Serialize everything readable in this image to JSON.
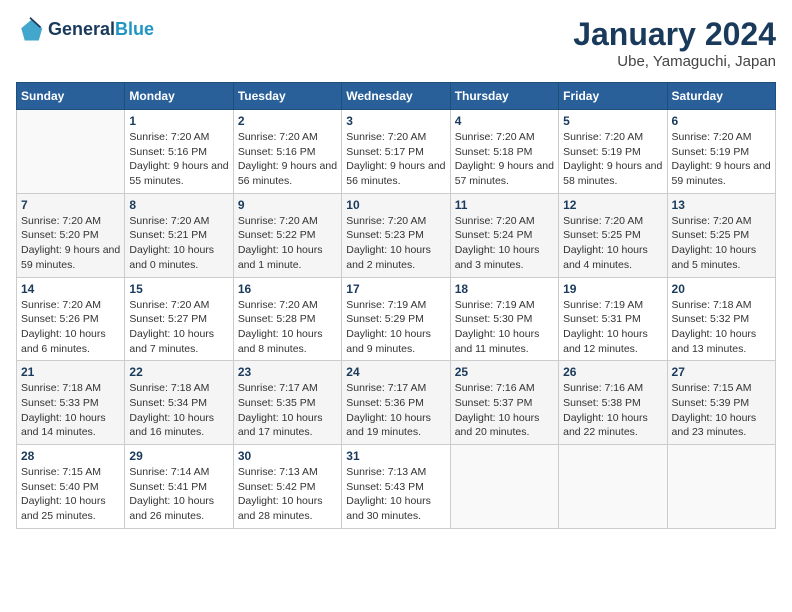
{
  "header": {
    "logo_line1": "General",
    "logo_line2": "Blue",
    "title": "January 2024",
    "subtitle": "Ube, Yamaguchi, Japan"
  },
  "days_of_week": [
    "Sunday",
    "Monday",
    "Tuesday",
    "Wednesday",
    "Thursday",
    "Friday",
    "Saturday"
  ],
  "weeks": [
    [
      {
        "day": "",
        "sunrise": "",
        "sunset": "",
        "daylight": ""
      },
      {
        "day": "1",
        "sunrise": "Sunrise: 7:20 AM",
        "sunset": "Sunset: 5:16 PM",
        "daylight": "Daylight: 9 hours and 55 minutes."
      },
      {
        "day": "2",
        "sunrise": "Sunrise: 7:20 AM",
        "sunset": "Sunset: 5:16 PM",
        "daylight": "Daylight: 9 hours and 56 minutes."
      },
      {
        "day": "3",
        "sunrise": "Sunrise: 7:20 AM",
        "sunset": "Sunset: 5:17 PM",
        "daylight": "Daylight: 9 hours and 56 minutes."
      },
      {
        "day": "4",
        "sunrise": "Sunrise: 7:20 AM",
        "sunset": "Sunset: 5:18 PM",
        "daylight": "Daylight: 9 hours and 57 minutes."
      },
      {
        "day": "5",
        "sunrise": "Sunrise: 7:20 AM",
        "sunset": "Sunset: 5:19 PM",
        "daylight": "Daylight: 9 hours and 58 minutes."
      },
      {
        "day": "6",
        "sunrise": "Sunrise: 7:20 AM",
        "sunset": "Sunset: 5:19 PM",
        "daylight": "Daylight: 9 hours and 59 minutes."
      }
    ],
    [
      {
        "day": "7",
        "sunrise": "Sunrise: 7:20 AM",
        "sunset": "Sunset: 5:20 PM",
        "daylight": "Daylight: 9 hours and 59 minutes."
      },
      {
        "day": "8",
        "sunrise": "Sunrise: 7:20 AM",
        "sunset": "Sunset: 5:21 PM",
        "daylight": "Daylight: 10 hours and 0 minutes."
      },
      {
        "day": "9",
        "sunrise": "Sunrise: 7:20 AM",
        "sunset": "Sunset: 5:22 PM",
        "daylight": "Daylight: 10 hours and 1 minute."
      },
      {
        "day": "10",
        "sunrise": "Sunrise: 7:20 AM",
        "sunset": "Sunset: 5:23 PM",
        "daylight": "Daylight: 10 hours and 2 minutes."
      },
      {
        "day": "11",
        "sunrise": "Sunrise: 7:20 AM",
        "sunset": "Sunset: 5:24 PM",
        "daylight": "Daylight: 10 hours and 3 minutes."
      },
      {
        "day": "12",
        "sunrise": "Sunrise: 7:20 AM",
        "sunset": "Sunset: 5:25 PM",
        "daylight": "Daylight: 10 hours and 4 minutes."
      },
      {
        "day": "13",
        "sunrise": "Sunrise: 7:20 AM",
        "sunset": "Sunset: 5:25 PM",
        "daylight": "Daylight: 10 hours and 5 minutes."
      }
    ],
    [
      {
        "day": "14",
        "sunrise": "Sunrise: 7:20 AM",
        "sunset": "Sunset: 5:26 PM",
        "daylight": "Daylight: 10 hours and 6 minutes."
      },
      {
        "day": "15",
        "sunrise": "Sunrise: 7:20 AM",
        "sunset": "Sunset: 5:27 PM",
        "daylight": "Daylight: 10 hours and 7 minutes."
      },
      {
        "day": "16",
        "sunrise": "Sunrise: 7:20 AM",
        "sunset": "Sunset: 5:28 PM",
        "daylight": "Daylight: 10 hours and 8 minutes."
      },
      {
        "day": "17",
        "sunrise": "Sunrise: 7:19 AM",
        "sunset": "Sunset: 5:29 PM",
        "daylight": "Daylight: 10 hours and 9 minutes."
      },
      {
        "day": "18",
        "sunrise": "Sunrise: 7:19 AM",
        "sunset": "Sunset: 5:30 PM",
        "daylight": "Daylight: 10 hours and 11 minutes."
      },
      {
        "day": "19",
        "sunrise": "Sunrise: 7:19 AM",
        "sunset": "Sunset: 5:31 PM",
        "daylight": "Daylight: 10 hours and 12 minutes."
      },
      {
        "day": "20",
        "sunrise": "Sunrise: 7:18 AM",
        "sunset": "Sunset: 5:32 PM",
        "daylight": "Daylight: 10 hours and 13 minutes."
      }
    ],
    [
      {
        "day": "21",
        "sunrise": "Sunrise: 7:18 AM",
        "sunset": "Sunset: 5:33 PM",
        "daylight": "Daylight: 10 hours and 14 minutes."
      },
      {
        "day": "22",
        "sunrise": "Sunrise: 7:18 AM",
        "sunset": "Sunset: 5:34 PM",
        "daylight": "Daylight: 10 hours and 16 minutes."
      },
      {
        "day": "23",
        "sunrise": "Sunrise: 7:17 AM",
        "sunset": "Sunset: 5:35 PM",
        "daylight": "Daylight: 10 hours and 17 minutes."
      },
      {
        "day": "24",
        "sunrise": "Sunrise: 7:17 AM",
        "sunset": "Sunset: 5:36 PM",
        "daylight": "Daylight: 10 hours and 19 minutes."
      },
      {
        "day": "25",
        "sunrise": "Sunrise: 7:16 AM",
        "sunset": "Sunset: 5:37 PM",
        "daylight": "Daylight: 10 hours and 20 minutes."
      },
      {
        "day": "26",
        "sunrise": "Sunrise: 7:16 AM",
        "sunset": "Sunset: 5:38 PM",
        "daylight": "Daylight: 10 hours and 22 minutes."
      },
      {
        "day": "27",
        "sunrise": "Sunrise: 7:15 AM",
        "sunset": "Sunset: 5:39 PM",
        "daylight": "Daylight: 10 hours and 23 minutes."
      }
    ],
    [
      {
        "day": "28",
        "sunrise": "Sunrise: 7:15 AM",
        "sunset": "Sunset: 5:40 PM",
        "daylight": "Daylight: 10 hours and 25 minutes."
      },
      {
        "day": "29",
        "sunrise": "Sunrise: 7:14 AM",
        "sunset": "Sunset: 5:41 PM",
        "daylight": "Daylight: 10 hours and 26 minutes."
      },
      {
        "day": "30",
        "sunrise": "Sunrise: 7:13 AM",
        "sunset": "Sunset: 5:42 PM",
        "daylight": "Daylight: 10 hours and 28 minutes."
      },
      {
        "day": "31",
        "sunrise": "Sunrise: 7:13 AM",
        "sunset": "Sunset: 5:43 PM",
        "daylight": "Daylight: 10 hours and 30 minutes."
      },
      {
        "day": "",
        "sunrise": "",
        "sunset": "",
        "daylight": ""
      },
      {
        "day": "",
        "sunrise": "",
        "sunset": "",
        "daylight": ""
      },
      {
        "day": "",
        "sunrise": "",
        "sunset": "",
        "daylight": ""
      }
    ]
  ]
}
